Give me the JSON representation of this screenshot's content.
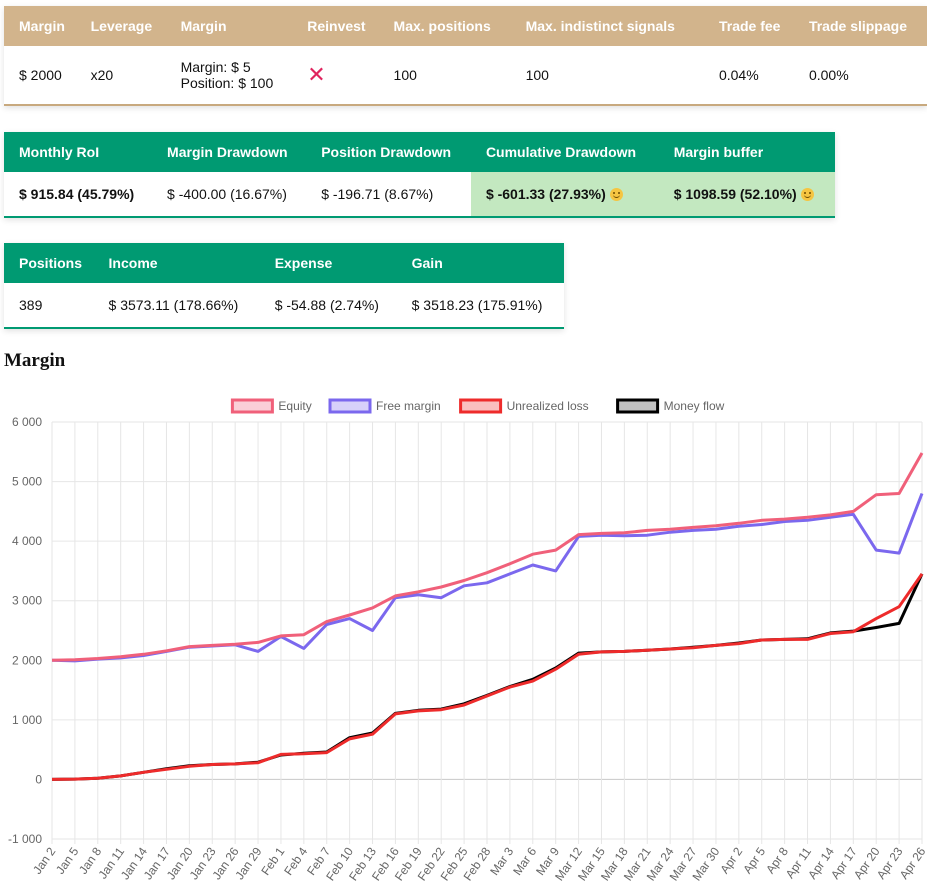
{
  "settings": {
    "headers": [
      "Margin",
      "Leverage",
      "Margin",
      "Reinvest",
      "Max. positions",
      "Max. indistinct signals",
      "Trade fee",
      "Trade slippage"
    ],
    "margin": "$ 2000",
    "leverage": "x20",
    "margin_line1": "Margin: $ 5",
    "margin_line2": "Position: $ 100",
    "reinvest_icon": "cross-icon",
    "reinvest_symbol": "✕",
    "max_positions": "100",
    "max_indistinct": "100",
    "trade_fee": "0.04%",
    "trade_slippage": "0.00%"
  },
  "roi": {
    "headers": [
      "Monthly RoI",
      "Margin Drawdown",
      "Position Drawdown",
      "Cumulative Drawdown",
      "Margin buffer"
    ],
    "monthly_roi": "$ 915.84 (45.79%)",
    "margin_drawdown": "$ -400.00 (16.67%)",
    "position_drawdown": "$ -196.71 (8.67%)",
    "cumulative_drawdown": "$ -601.33 (27.93%)",
    "margin_buffer": "$ 1098.59 (52.10%)",
    "smiley_icon": "smiley-icon",
    "highlight_color": "#c3e8c0"
  },
  "positions": {
    "headers": [
      "Positions",
      "Income",
      "Expense",
      "Gain"
    ],
    "count": "389",
    "income": "$ 3573.11 (178.66%)",
    "expense": "$ -54.88 (2.74%)",
    "gain": "$ 3518.23 (175.91%)"
  },
  "colors": {
    "settings_header": "#d2b48c",
    "metrics_header": "#009a72"
  },
  "section_title": "Margin",
  "chart_data": {
    "type": "line",
    "title": "Margin",
    "ylim": [
      -1000,
      6000
    ],
    "yticks": [
      6000,
      5000,
      4000,
      3000,
      2000,
      1000,
      0,
      -1000
    ],
    "ytick_labels": [
      "6 000",
      "5 000",
      "4 000",
      "3 000",
      "2 000",
      "1 000",
      "0",
      "-1 000"
    ],
    "xtick_labels": [
      "Jan 2",
      "Jan 5",
      "Jan 8",
      "Jan 11",
      "Jan 14",
      "Jan 17",
      "Jan 20",
      "Jan 23",
      "Jan 26",
      "Jan 29",
      "Feb 1",
      "Feb 4",
      "Feb 7",
      "Feb 10",
      "Feb 13",
      "Feb 16",
      "Feb 19",
      "Feb 22",
      "Feb 25",
      "Feb 28",
      "Mar 3",
      "Mar 6",
      "Mar 9",
      "Mar 12",
      "Mar 15",
      "Mar 18",
      "Mar 21",
      "Mar 24",
      "Mar 27",
      "Mar 30",
      "Apr 2",
      "Apr 5",
      "Apr 8",
      "Apr 11",
      "Apr 14",
      "Apr 17",
      "Apr 20",
      "Apr 23",
      "Apr 26"
    ],
    "x": [
      "Jan 2",
      "Jan 5",
      "Jan 8",
      "Jan 11",
      "Jan 14",
      "Jan 17",
      "Jan 20",
      "Jan 23",
      "Jan 26",
      "Jan 29",
      "Feb 1",
      "Feb 4",
      "Feb 7",
      "Feb 10",
      "Feb 13",
      "Feb 16",
      "Feb 19",
      "Feb 22",
      "Feb 25",
      "Feb 28",
      "Mar 3",
      "Mar 6",
      "Mar 9",
      "Mar 12",
      "Mar 15",
      "Mar 18",
      "Mar 21",
      "Mar 24",
      "Mar 27",
      "Mar 30",
      "Apr 2",
      "Apr 5",
      "Apr 8",
      "Apr 11",
      "Apr 14",
      "Apr 17",
      "Apr 20",
      "Apr 23",
      "Apr 26"
    ],
    "legend_position": "top-center",
    "grid": true,
    "series": [
      {
        "name": "Equity",
        "color": "#f0607a",
        "values": [
          2000,
          2010,
          2030,
          2060,
          2100,
          2160,
          2230,
          2250,
          2270,
          2300,
          2410,
          2430,
          2650,
          2760,
          2880,
          3080,
          3150,
          3230,
          3340,
          3470,
          3620,
          3780,
          3850,
          4110,
          4130,
          4140,
          4180,
          4200,
          4230,
          4260,
          4300,
          4350,
          4370,
          4400,
          4440,
          4500,
          4780,
          4800,
          5480
        ]
      },
      {
        "name": "Free margin",
        "color": "#7b68ee",
        "values": [
          2000,
          1990,
          2020,
          2040,
          2080,
          2150,
          2220,
          2240,
          2260,
          2150,
          2400,
          2200,
          2600,
          2700,
          2500,
          3050,
          3100,
          3050,
          3250,
          3300,
          3450,
          3600,
          3500,
          4080,
          4100,
          4090,
          4100,
          4150,
          4180,
          4200,
          4250,
          4280,
          4330,
          4350,
          4400,
          4450,
          3850,
          3800,
          4800
        ]
      },
      {
        "name": "Unrealized loss",
        "color": "#ee2b2b",
        "values": [
          0,
          5,
          20,
          60,
          120,
          170,
          220,
          250,
          260,
          280,
          420,
          430,
          450,
          680,
          760,
          1100,
          1150,
          1170,
          1250,
          1400,
          1550,
          1650,
          1850,
          2100,
          2140,
          2150,
          2170,
          2190,
          2210,
          2250,
          2280,
          2340,
          2350,
          2350,
          2450,
          2480,
          2700,
          2900,
          3450
        ]
      },
      {
        "name": "Money flow",
        "color": "#000000",
        "values": [
          0,
          5,
          20,
          60,
          120,
          180,
          230,
          250,
          260,
          290,
          410,
          440,
          460,
          700,
          780,
          1110,
          1160,
          1180,
          1270,
          1410,
          1560,
          1680,
          1870,
          2120,
          2140,
          2150,
          2170,
          2190,
          2220,
          2250,
          2290,
          2340,
          2350,
          2360,
          2460,
          2490,
          2550,
          2620,
          3450
        ]
      }
    ]
  }
}
